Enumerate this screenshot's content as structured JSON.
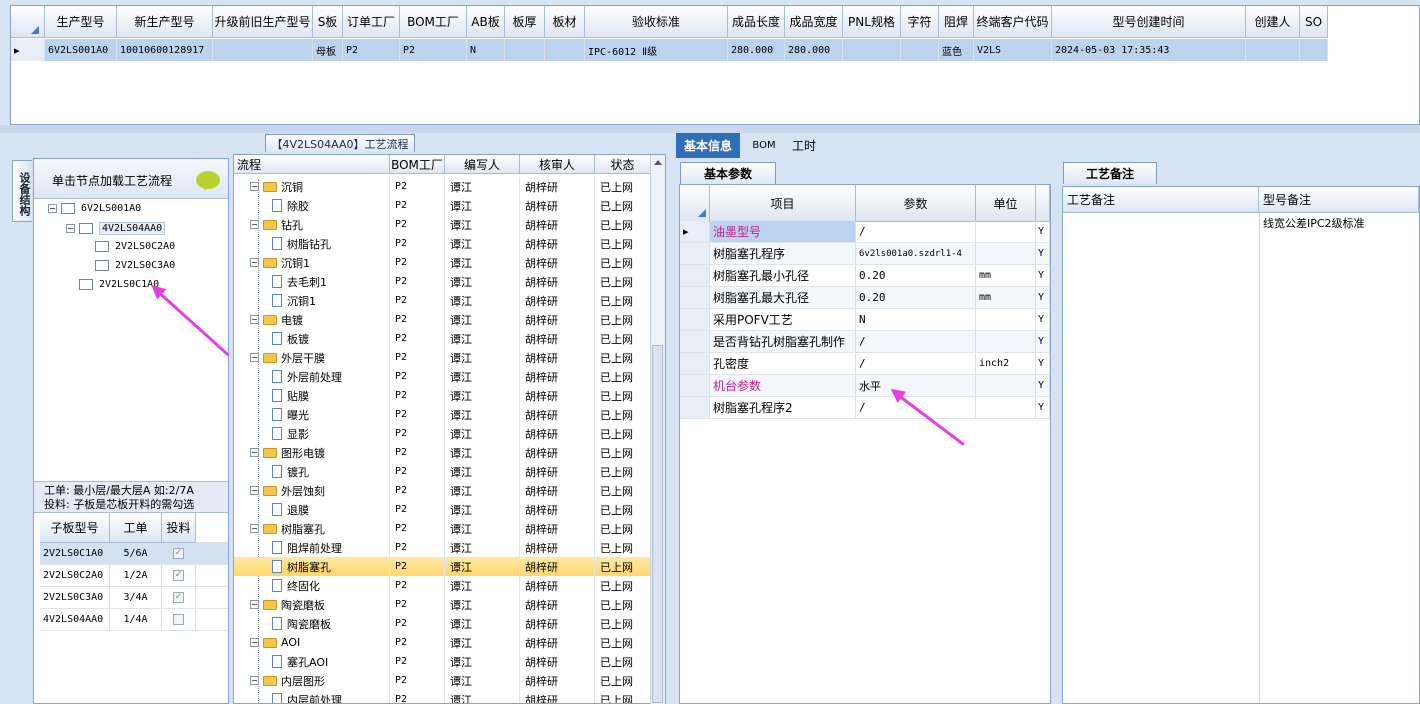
{
  "top_grid": {
    "columns": [
      "生产型号",
      "新生产型号",
      "升级前旧生产型号",
      "S板",
      "订单工厂",
      "BOM工厂",
      "AB板",
      "板厚",
      "板材",
      "验收标准",
      "成品长度",
      "成品宽度",
      "PNL规格",
      "字符",
      "阻焊",
      "终端客户代码",
      "型号创建时间",
      "创建人",
      "SO"
    ],
    "row": [
      "6V2LS001A0",
      "10010600128917",
      "",
      "母板",
      "P2",
      "P2",
      "N",
      "",
      "",
      "IPC-6012 Ⅱ级",
      "280.000",
      "280.000",
      "",
      "",
      "蓝色",
      "V2LS",
      "2024-05-03 17:35:43",
      "",
      ""
    ]
  },
  "left": {
    "vertical_tab": "设备结构",
    "load_hint": "单击节点加载工艺流程",
    "tree": [
      "6V2LS001A0",
      "4V2LS04AA0",
      "2V2LS0C2A0",
      "2V2LS0C3A0",
      "2V2LS0C1A0"
    ],
    "work_info_1": "工单: 最小层/最大层A 如:2/7A",
    "work_info_2": "投料: 子板是芯板开料的需勾选",
    "sub_columns": [
      "子板型号",
      "工单",
      "投料"
    ],
    "sub_rows": [
      {
        "model": "2V2LS0C1A0",
        "work": "5/6A",
        "checked": true
      },
      {
        "model": "2V2LS0C2A0",
        "work": "1/2A",
        "checked": true
      },
      {
        "model": "2V2LS0C3A0",
        "work": "3/4A",
        "checked": true
      },
      {
        "model": "4V2LS04AA0",
        "work": "1/4A",
        "checked": false
      }
    ]
  },
  "middle": {
    "title": "【4V2LS04AA0】工艺流程",
    "columns": [
      "流程",
      "BOM工厂",
      "编写人",
      "核审人",
      "状态"
    ],
    "rows": [
      {
        "name": "沉铜",
        "type": "folder",
        "bom": "P2",
        "writer": "谭江",
        "reviewer": "胡梓研",
        "status": "已上网"
      },
      {
        "name": "除胶",
        "type": "doc",
        "bom": "P2",
        "writer": "谭江",
        "reviewer": "胡梓研",
        "status": "已上网"
      },
      {
        "name": "钻孔",
        "type": "folder",
        "bom": "P2",
        "writer": "谭江",
        "reviewer": "胡梓研",
        "status": "已上网"
      },
      {
        "name": "树脂钻孔",
        "type": "doc",
        "bom": "P2",
        "writer": "谭江",
        "reviewer": "胡梓研",
        "status": "已上网"
      },
      {
        "name": "沉铜1",
        "type": "folder",
        "bom": "P2",
        "writer": "谭江",
        "reviewer": "胡梓研",
        "status": "已上网"
      },
      {
        "name": "去毛刺1",
        "type": "doc",
        "bom": "P2",
        "writer": "谭江",
        "reviewer": "胡梓研",
        "status": "已上网"
      },
      {
        "name": "沉铜1",
        "type": "doc",
        "bom": "P2",
        "writer": "谭江",
        "reviewer": "胡梓研",
        "status": "已上网"
      },
      {
        "name": "电镀",
        "type": "folder",
        "bom": "P2",
        "writer": "谭江",
        "reviewer": "胡梓研",
        "status": "已上网"
      },
      {
        "name": "板镀",
        "type": "doc",
        "bom": "P2",
        "writer": "谭江",
        "reviewer": "胡梓研",
        "status": "已上网"
      },
      {
        "name": "外层干膜",
        "type": "folder",
        "bom": "P2",
        "writer": "谭江",
        "reviewer": "胡梓研",
        "status": "已上网"
      },
      {
        "name": "外层前处理",
        "type": "doc",
        "bom": "P2",
        "writer": "谭江",
        "reviewer": "胡梓研",
        "status": "已上网"
      },
      {
        "name": "贴膜",
        "type": "doc",
        "bom": "P2",
        "writer": "谭江",
        "reviewer": "胡梓研",
        "status": "已上网"
      },
      {
        "name": "曝光",
        "type": "doc",
        "bom": "P2",
        "writer": "谭江",
        "reviewer": "胡梓研",
        "status": "已上网"
      },
      {
        "name": "显影",
        "type": "doc",
        "bom": "P2",
        "writer": "谭江",
        "reviewer": "胡梓研",
        "status": "已上网"
      },
      {
        "name": "图形电镀",
        "type": "folder",
        "bom": "P2",
        "writer": "谭江",
        "reviewer": "胡梓研",
        "status": "已上网"
      },
      {
        "name": "镀孔",
        "type": "doc",
        "bom": "P2",
        "writer": "谭江",
        "reviewer": "胡梓研",
        "status": "已上网"
      },
      {
        "name": "外层蚀刻",
        "type": "folder",
        "bom": "P2",
        "writer": "谭江",
        "reviewer": "胡梓研",
        "status": "已上网"
      },
      {
        "name": "退膜",
        "type": "doc",
        "bom": "P2",
        "writer": "谭江",
        "reviewer": "胡梓研",
        "status": "已上网"
      },
      {
        "name": "树脂塞孔",
        "type": "folder",
        "bom": "P2",
        "writer": "谭江",
        "reviewer": "胡梓研",
        "status": "已上网"
      },
      {
        "name": "阻焊前处理",
        "type": "doc",
        "bom": "P2",
        "writer": "谭江",
        "reviewer": "胡梓研",
        "status": "已上网"
      },
      {
        "name": "树脂塞孔",
        "type": "doc",
        "bom": "P2",
        "writer": "谭江",
        "reviewer": "胡梓研",
        "status": "已上网",
        "selected": true
      },
      {
        "name": "终固化",
        "type": "doc",
        "bom": "P2",
        "writer": "谭江",
        "reviewer": "胡梓研",
        "status": "已上网"
      },
      {
        "name": "陶瓷磨板",
        "type": "folder",
        "bom": "P2",
        "writer": "谭江",
        "reviewer": "胡梓研",
        "status": "已上网"
      },
      {
        "name": "陶瓷磨板",
        "type": "doc",
        "bom": "P2",
        "writer": "谭江",
        "reviewer": "胡梓研",
        "status": "已上网"
      },
      {
        "name": "AOI",
        "type": "folder",
        "bom": "P2",
        "writer": "谭江",
        "reviewer": "胡梓研",
        "status": "已上网"
      },
      {
        "name": "塞孔AOI",
        "type": "doc",
        "bom": "P2",
        "writer": "谭江",
        "reviewer": "胡梓研",
        "status": "已上网"
      },
      {
        "name": "内层图形",
        "type": "folder",
        "bom": "P2",
        "writer": "谭江",
        "reviewer": "胡梓研",
        "status": "已上网"
      },
      {
        "name": "内层前处理",
        "type": "doc",
        "bom": "P2",
        "writer": "谭江",
        "reviewer": "胡梓研",
        "status": "已上网"
      }
    ]
  },
  "right": {
    "tabs": [
      "基本信息",
      "BOM",
      "工时"
    ],
    "param_tab": "基本参数",
    "param_columns": [
      "项目",
      "参数",
      "单位"
    ],
    "params": [
      {
        "item": "油墨型号",
        "value": "/",
        "unit": "",
        "flag": "Y",
        "highlight": true
      },
      {
        "item": "树脂塞孔程序",
        "value": "6v2ls001a0.szdrl1-4",
        "unit": "",
        "flag": "Y"
      },
      {
        "item": "树脂塞孔最小孔径",
        "value": "0.20",
        "unit": "mm",
        "flag": "Y"
      },
      {
        "item": "树脂塞孔最大孔径",
        "value": "0.20",
        "unit": "mm",
        "flag": "Y"
      },
      {
        "item": "采用POFV工艺",
        "value": "N",
        "unit": "",
        "flag": "Y"
      },
      {
        "item": "是否背钻孔树脂塞孔制作",
        "value": "/",
        "unit": "",
        "flag": "Y"
      },
      {
        "item": "孔密度",
        "value": "/",
        "unit": "inch2",
        "flag": "Y"
      },
      {
        "item": "机台参数",
        "value": "水平",
        "unit": "",
        "flag": "Y",
        "highlight": true
      },
      {
        "item": "树脂塞孔程序2",
        "value": "/",
        "unit": "",
        "flag": "Y"
      }
    ],
    "note_tab": "工艺备注",
    "note_columns": [
      "工艺备注",
      "型号备注"
    ],
    "model_note": "线宽公差IPC2级标准"
  },
  "colors": {
    "accent": "#2f6fb8",
    "selected_row": "#ffd76b",
    "highlight_text": "#c0208a",
    "arrow": "#e53fe3"
  }
}
